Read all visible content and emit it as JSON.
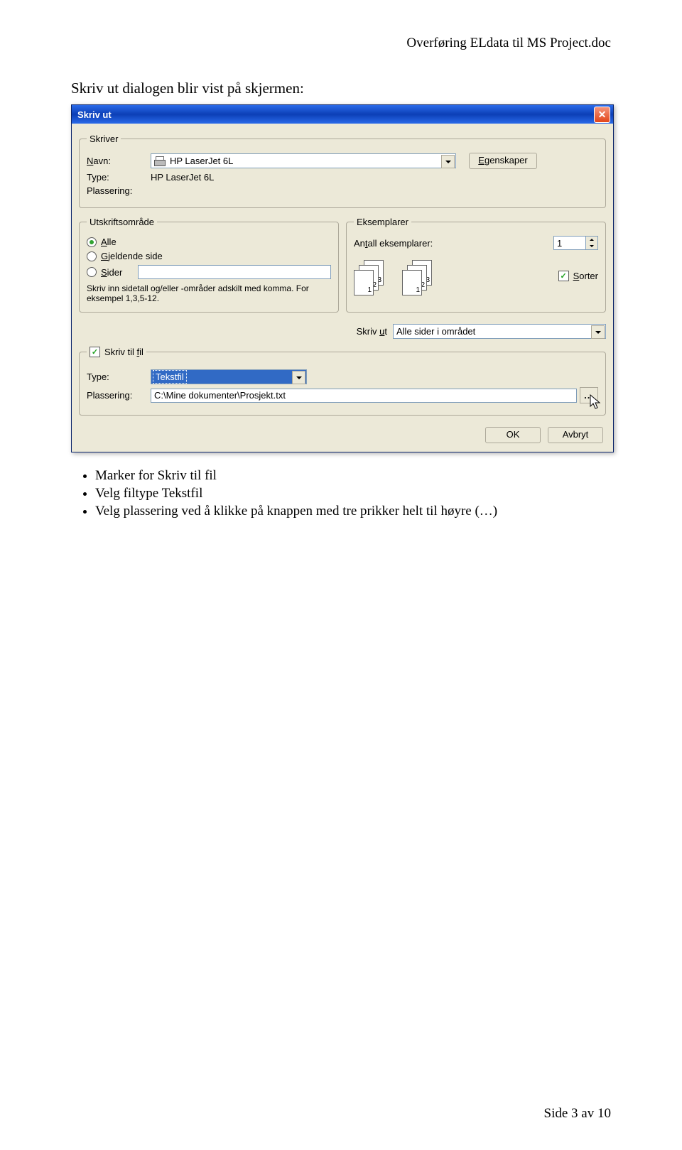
{
  "doc_header": "Overføring ELdata til MS Project.doc",
  "intro": "Skriv ut dialogen blir vist på skjermen:",
  "dialog": {
    "title": "Skriv ut",
    "printer_group": "Skriver",
    "name_label": "Navn:",
    "name_value": "HP LaserJet 6L",
    "type_label": "Type:",
    "type_value": "HP LaserJet 6L",
    "location_label": "Plassering:",
    "properties_btn": "Egenskaper",
    "range_group": "Utskriftsområde",
    "range_all": "Alle",
    "range_current": "Gjeldende side",
    "range_pages": "Sider",
    "range_help": "Skriv inn sidetall og/eller -områder adskilt med komma. For eksempel 1,3,5-12.",
    "copies_group": "Eksemplarer",
    "copies_count_label": "Antall eksemplarer:",
    "copies_count_value": "1",
    "collate_label": "Sorter",
    "print_what_label": "Skriv ut",
    "print_what_value": "Alle sider i området",
    "to_file_group": "Skriv til fil",
    "file_type_label": "Type:",
    "file_type_value": "Tekstfil",
    "file_loc_label": "Plassering:",
    "file_loc_value": "C:\\Mine dokumenter\\Prosjekt.txt",
    "browse_btn": "...",
    "ok_btn": "OK",
    "cancel_btn": "Avbryt"
  },
  "notes": {
    "n1": "Marker for Skriv til fil",
    "n2": "Velg filtype Tekstfil",
    "n3": "Velg plassering ved å klikke på knappen med tre prikker helt til høyre (…)"
  },
  "footer": "Side 3 av 10"
}
